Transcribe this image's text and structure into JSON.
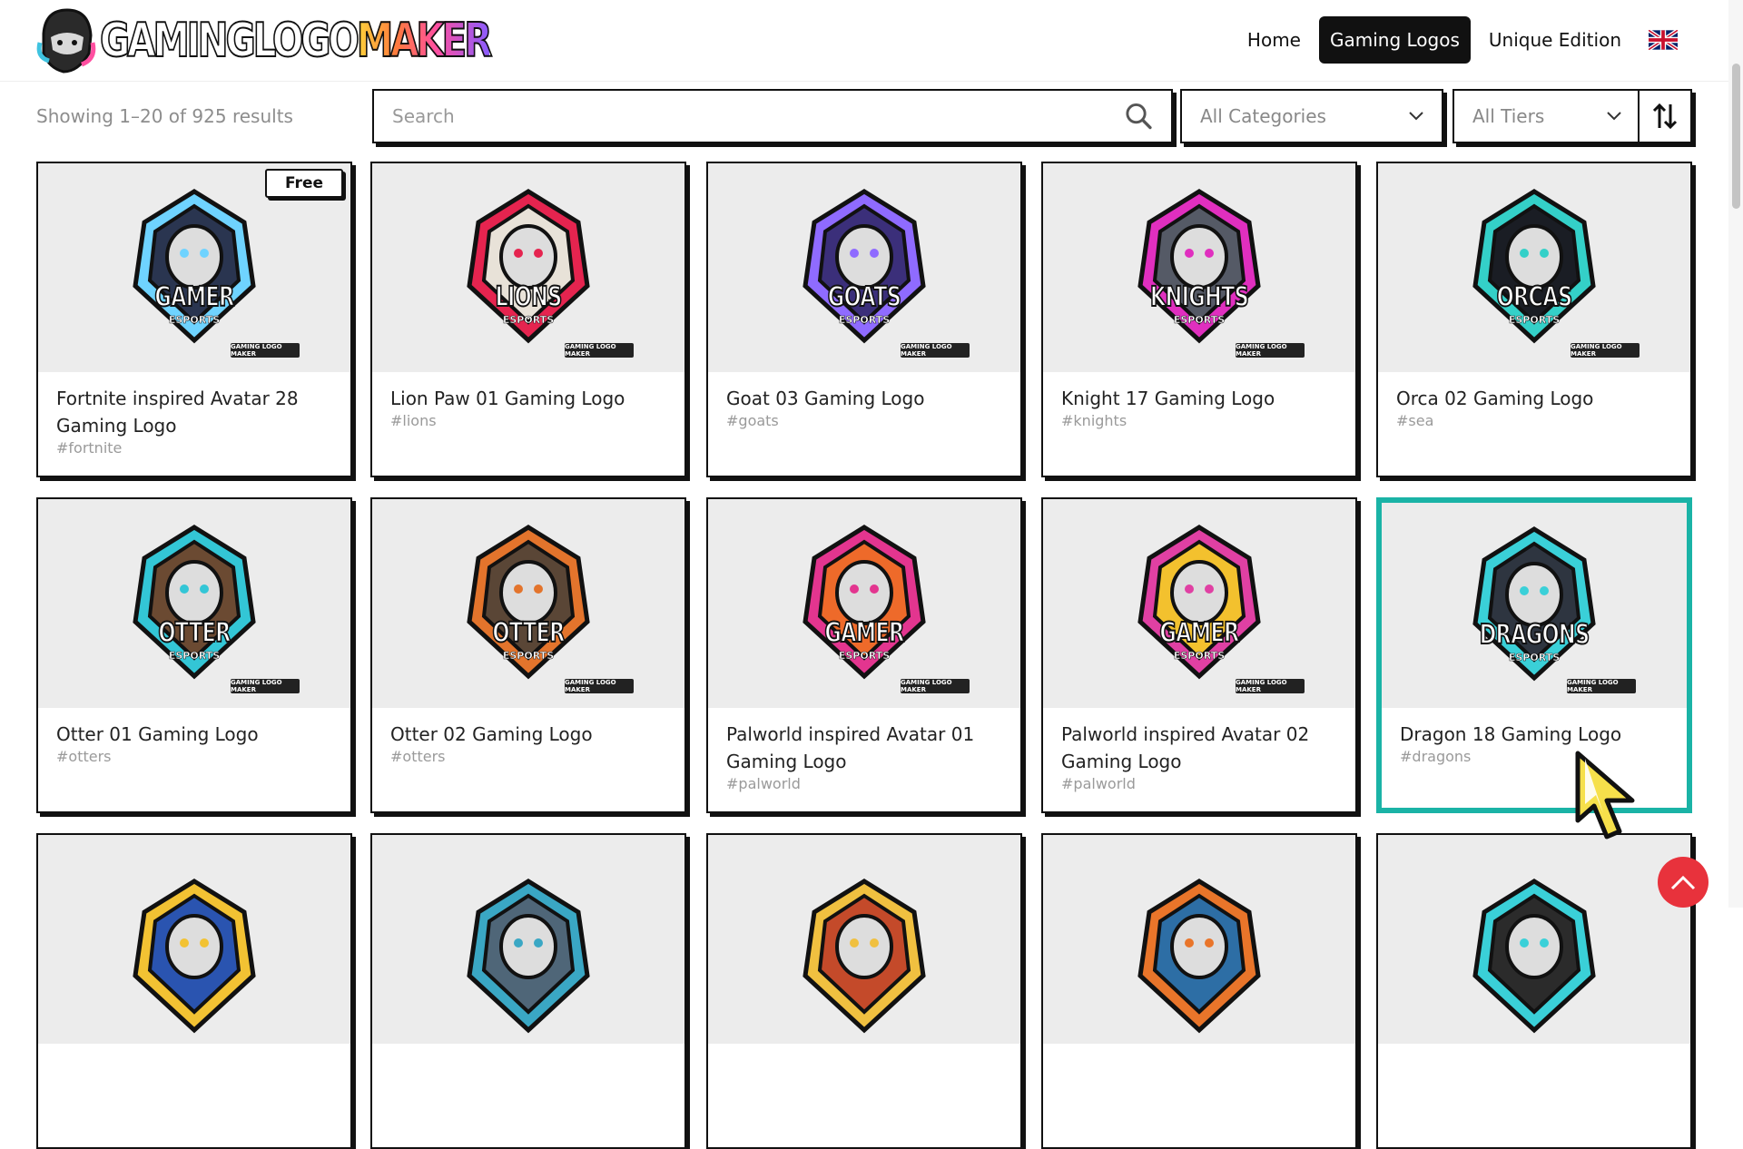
{
  "brand": {
    "name_white": "GAMINGLOGO",
    "name_color": "MAKER"
  },
  "nav": {
    "home": "Home",
    "gaming_logos": "Gaming Logos",
    "unique_edition": "Unique Edition",
    "language_icon": "uk-flag-icon"
  },
  "toolbar": {
    "results_text": "Showing 1–20 of 925 results",
    "search_placeholder": "Search",
    "category_value": "All Categories",
    "tier_value": "All Tiers"
  },
  "watermark": "GAMING LOGO MAKER",
  "badge_free": "Free",
  "cards": [
    {
      "title": "Fortnite inspired Avatar 28 Gaming Logo",
      "tag": "#fortnite",
      "emblem": "GAMER",
      "sub": "ESPORTS",
      "color": "#2a3550",
      "accent": "#6fd3ff"
    },
    {
      "title": "Lion Paw 01 Gaming Logo",
      "tag": "#lions",
      "emblem": "LIONS",
      "sub": "ESPORTS",
      "color": "#e8e2d8",
      "accent": "#e5244f"
    },
    {
      "title": "Goat 03 Gaming Logo",
      "tag": "#goats",
      "emblem": "GOATS",
      "sub": "ESPORTS",
      "color": "#3b2f7a",
      "accent": "#8f6bff"
    },
    {
      "title": "Knight 17 Gaming Logo",
      "tag": "#knights",
      "emblem": "KNIGHTS",
      "sub": "ESPORTS",
      "color": "#555a66",
      "accent": "#e02fbf"
    },
    {
      "title": "Orca 02 Gaming Logo",
      "tag": "#sea",
      "emblem": "ORCAS",
      "sub": "ESPORTS",
      "color": "#1a1d24",
      "accent": "#34d0c8"
    },
    {
      "title": "Otter 01 Gaming Logo",
      "tag": "#otters",
      "emblem": "OTTER",
      "sub": "ESPORTS",
      "color": "#6b4a32",
      "accent": "#33c6d6"
    },
    {
      "title": "Otter 02 Gaming Logo",
      "tag": "#otters",
      "emblem": "OTTER",
      "sub": "ESPORTS",
      "color": "#5a4636",
      "accent": "#e3742c"
    },
    {
      "title": "Palworld inspired Avatar 01 Gaming Logo",
      "tag": "#palworld",
      "emblem": "GAMER",
      "sub": "ESPORTS",
      "color": "#ee6a2a",
      "accent": "#e3358f"
    },
    {
      "title": "Palworld inspired Avatar 02 Gaming Logo",
      "tag": "#palworld",
      "emblem": "GAMER",
      "sub": "ESPORTS",
      "color": "#f3c12e",
      "accent": "#e040a3"
    },
    {
      "title": "Dragon 18 Gaming Logo",
      "tag": "#dragons",
      "emblem": "DRAGONS",
      "sub": "ESPORTS",
      "color": "#2e3540",
      "accent": "#3ad0d8"
    }
  ],
  "row3": [
    {
      "color": "#2a54b0",
      "accent": "#f2c233"
    },
    {
      "color": "#4f6678",
      "accent": "#3aa7c4"
    },
    {
      "color": "#c44a2a",
      "accent": "#f0c040"
    },
    {
      "color": "#2d6ea5",
      "accent": "#e9752a"
    },
    {
      "color": "#2b2b2b",
      "accent": "#3ad0d8"
    }
  ]
}
